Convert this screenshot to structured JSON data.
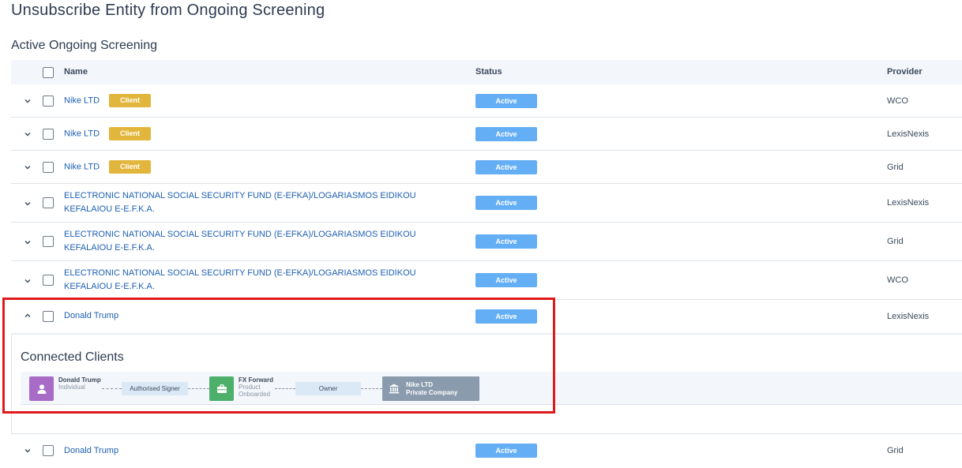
{
  "page_title": "Unsubscribe Entity from Ongoing Screening",
  "section_title": "Active Ongoing Screening",
  "columns": {
    "name": "Name",
    "status": "Status",
    "provider": "Provider"
  },
  "rows": [
    {
      "name": "Nike LTD",
      "badge": "Client",
      "status": "Active",
      "provider": "WCO"
    },
    {
      "name": "Nike LTD",
      "badge": "Client",
      "status": "Active",
      "provider": "LexisNexis"
    },
    {
      "name": "Nike LTD",
      "badge": "Client",
      "status": "Active",
      "provider": "Grid"
    },
    {
      "name": "ELECTRONIC NATIONAL SOCIAL SECURITY FUND (E-EFKA)/LOGARIASMOS EIDIKOU KEFALAIOU E-E.F.K.A.",
      "status": "Active",
      "provider": "LexisNexis"
    },
    {
      "name": "ELECTRONIC NATIONAL SOCIAL SECURITY FUND (E-EFKA)/LOGARIASMOS EIDIKOU KEFALAIOU E-E.F.K.A.",
      "status": "Active",
      "provider": "Grid"
    },
    {
      "name": "ELECTRONIC NATIONAL SOCIAL SECURITY FUND (E-EFKA)/LOGARIASMOS EIDIKOU KEFALAIOU E-E.F.K.A.",
      "status": "Active",
      "provider": "WCO"
    },
    {
      "name": "Donald Trump",
      "status": "Active",
      "provider": "LexisNexis"
    },
    {
      "name": "Donald Trump",
      "status": "Active",
      "provider": "Grid"
    }
  ],
  "connected_clients": {
    "title": "Connected Clients",
    "person": {
      "name": "Donald Trump",
      "type": "Individual",
      "icon": "person-icon",
      "color": "#a86cc7"
    },
    "edge1": "Authorised Signer",
    "product": {
      "name": "FX Forward",
      "type": "Product",
      "state": "Onboarded",
      "icon": "briefcase-icon",
      "color": "#4caf6a"
    },
    "edge2": "Owner",
    "company": {
      "name": "Nike LTD",
      "type": "Private Company",
      "icon": "bank-icon",
      "color": "#8a9bad"
    }
  },
  "colors": {
    "status_active": "#64aef5",
    "client_badge": "#e2b53c",
    "highlight": "#e0191b",
    "link": "#1d5fb3"
  }
}
